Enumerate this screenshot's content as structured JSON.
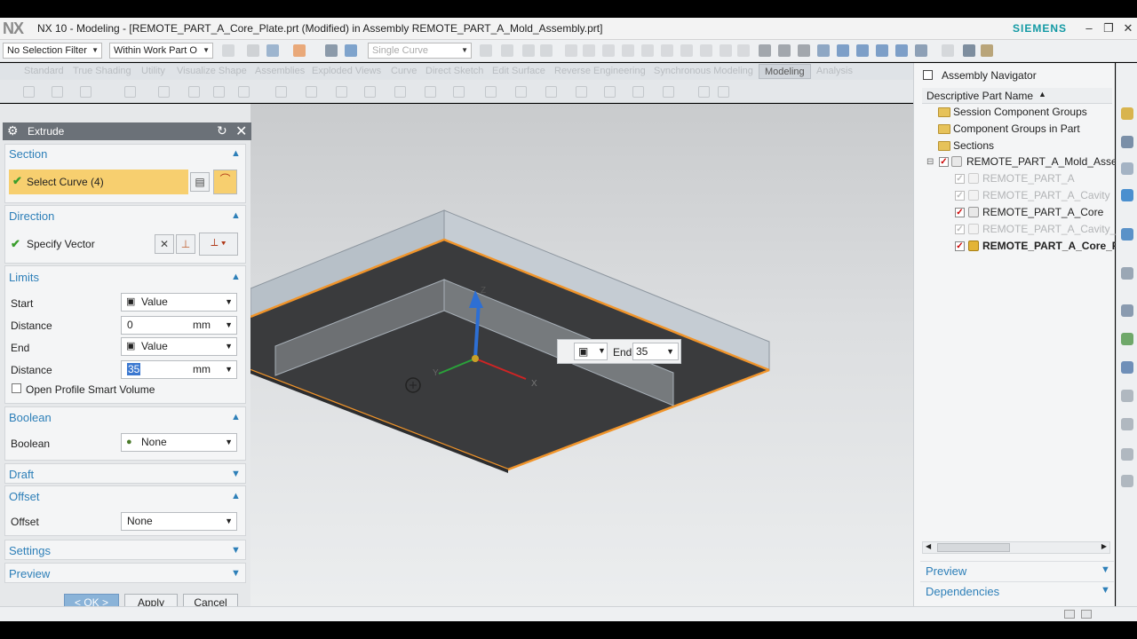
{
  "window": {
    "app": "NX 10",
    "title": "NX 10 - Modeling - [REMOTE_PART_A_Core_Plate.prt (Modified)  in Assembly REMOTE_PART_A_Mold_Assembly.prt]",
    "brand": "SIEMENS",
    "logo": "NX"
  },
  "toolbar": {
    "selection_filter": "No Selection Filter",
    "scope": "Within Work Part O",
    "curve_rule": "Single Curve"
  },
  "ribbon_tabs": [
    "Standard",
    "True Shading",
    "Utility",
    "Visualize Shape",
    "Assemblies",
    "Exploded Views",
    "Curve",
    "Direct Sketch",
    "Edit Surface",
    "Reverse Engineering",
    "Synchronous Modeling",
    "Modeling",
    "Analysis"
  ],
  "active_tab": "Modeling",
  "extrude": {
    "title": "Extrude",
    "section": {
      "header": "Section",
      "select_curve": "Select Curve (4)"
    },
    "direction": {
      "header": "Direction",
      "specify_vector": "Specify Vector"
    },
    "limits": {
      "header": "Limits",
      "start_label": "Start",
      "start_value": "Value",
      "start_distance_label": "Distance",
      "start_distance": "0",
      "end_label": "End",
      "end_value": "Value",
      "end_distance_label": "Distance",
      "end_distance": "35",
      "unit": "mm",
      "open_profile": "Open Profile Smart Volume"
    },
    "boolean": {
      "header": "Boolean",
      "label": "Boolean",
      "value": "None"
    },
    "draft": {
      "header": "Draft"
    },
    "offset": {
      "header": "Offset",
      "label": "Offset",
      "value": "None"
    },
    "settings": {
      "header": "Settings"
    },
    "preview": {
      "header": "Preview"
    },
    "buttons": {
      "ok": "< OK >",
      "apply": "Apply",
      "cancel": "Cancel"
    }
  },
  "viewport": {
    "end_popup_label": "End",
    "end_popup_value": "35",
    "triad": {
      "x": "X",
      "y": "Y",
      "z": "Z"
    }
  },
  "assembly_navigator": {
    "title": "Assembly Navigator",
    "column": "Descriptive Part Name",
    "items": [
      {
        "label": "Session Component Groups"
      },
      {
        "label": "Component Groups in Part"
      },
      {
        "label": "Sections"
      },
      {
        "label": "REMOTE_PART_A_Mold_Asse..."
      },
      {
        "label": "REMOTE_PART_A"
      },
      {
        "label": "REMOTE_PART_A_Cavity"
      },
      {
        "label": "REMOTE_PART_A_Core"
      },
      {
        "label": "REMOTE_PART_A_Cavity_P..."
      },
      {
        "label": "REMOTE_PART_A_Core_Pl..."
      }
    ],
    "preview": "Preview",
    "dependencies": "Dependencies"
  },
  "colors": {
    "accent_blue": "#2d7fb8",
    "selection_yellow": "#f7cf6f",
    "edge_orange": "#f0942a",
    "siemens_teal": "#139aa4",
    "ok_blue": "#8ab3d8"
  }
}
